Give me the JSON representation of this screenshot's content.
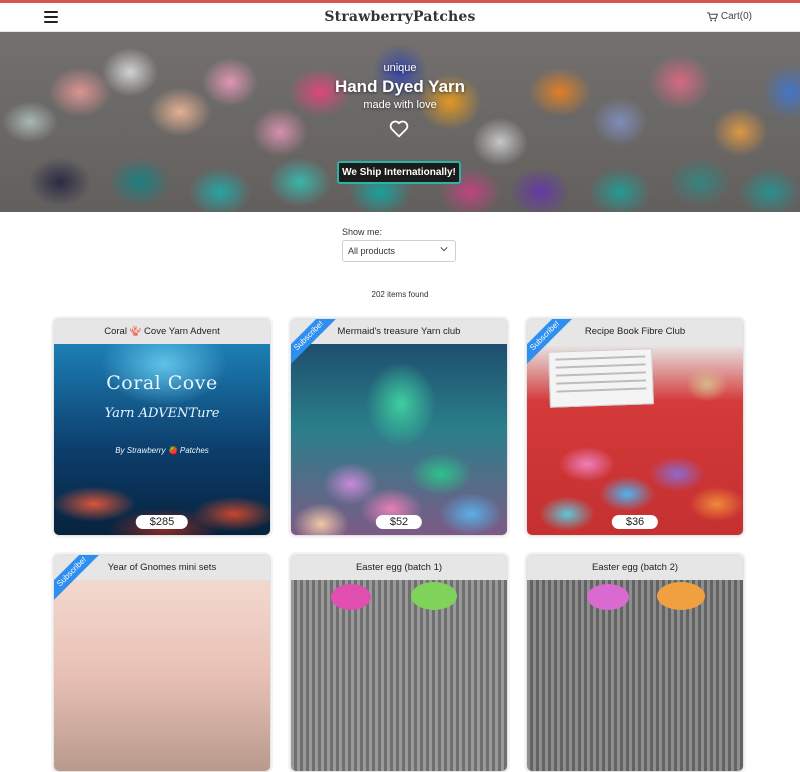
{
  "header": {
    "logo": "StrawberryPatches",
    "cart_label": "Cart(0)"
  },
  "hero": {
    "small_text": "unique",
    "title": "Hand Dyed Yarn",
    "subtitle": "made with love",
    "ship_button": "We Ship Internationally!"
  },
  "filter": {
    "label": "Show me:",
    "selected": "All products"
  },
  "results": {
    "count_text": "202 items found"
  },
  "products": [
    {
      "title": "Coral 🪸 Cove Yarn Advent",
      "price": "$285",
      "image_text_1": "Coral Cove",
      "image_text_2": "Yarn ADVENTure",
      "image_text_3": "By Strawberry 🍓 Patches"
    },
    {
      "title": "Mermaid's treasure Yarn club",
      "price": "$52",
      "ribbon": "Subscribe!"
    },
    {
      "title": "Recipe Book Fibre Club",
      "price": "$36",
      "ribbon": "Subscribe!"
    },
    {
      "title": "Year of Gnomes mini sets",
      "ribbon": "Subscribe!"
    },
    {
      "title": "Easter egg (batch 1)"
    },
    {
      "title": "Easter egg (batch 2)"
    }
  ],
  "colors": {
    "accent_top": "#d9534f",
    "ribbon": "#2f8ff0",
    "ship_border": "#2bb3a8"
  },
  "icons": [
    "menu-icon",
    "cart-icon",
    "heart-icon",
    "chevron-down-icon"
  ]
}
